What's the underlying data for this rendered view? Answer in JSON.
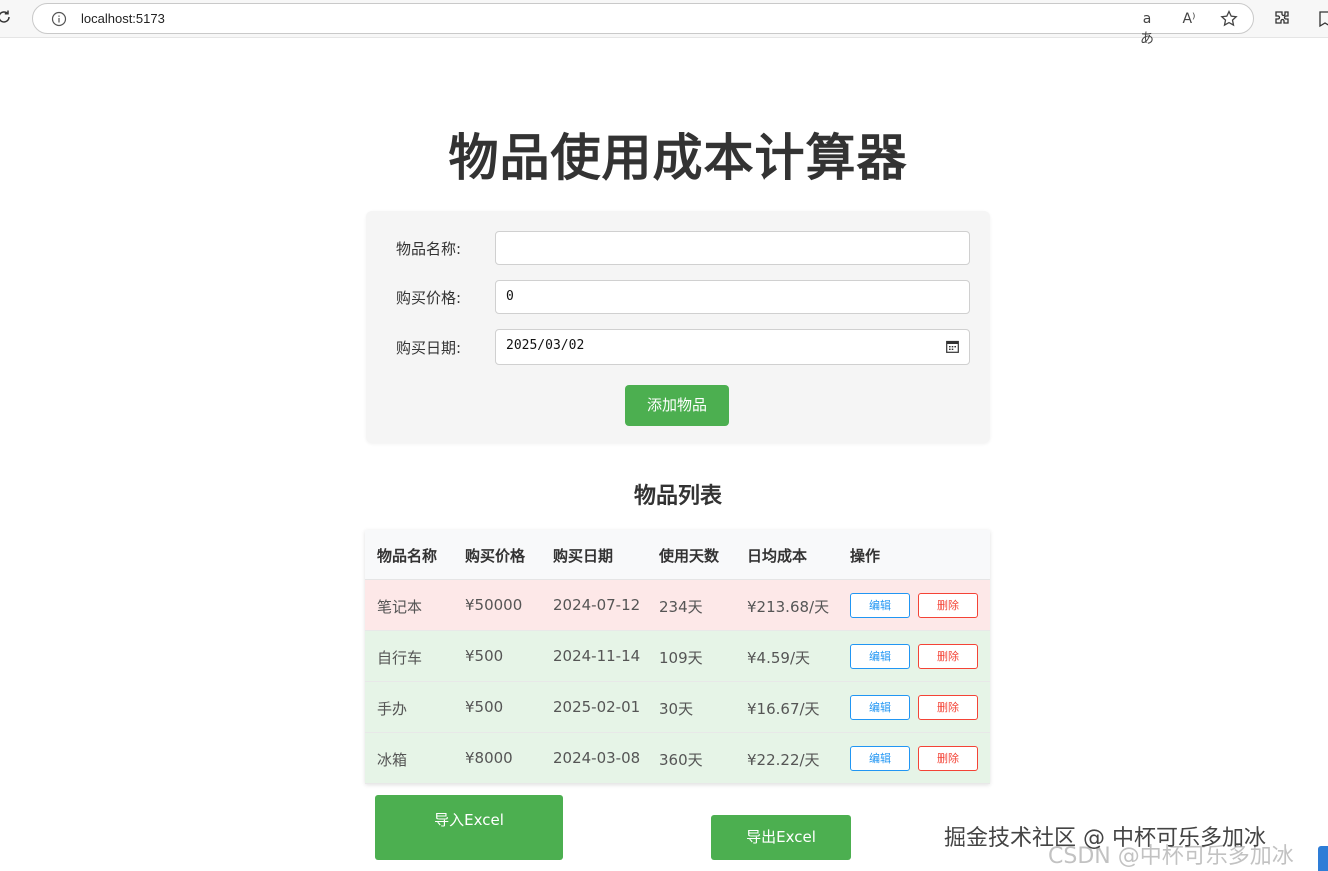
{
  "browser": {
    "url": "localhost:5173"
  },
  "page": {
    "title": "物品使用成本计算器"
  },
  "form": {
    "name_label": "物品名称:",
    "name_value": "",
    "price_label": "购买价格:",
    "price_value": "0",
    "date_label": "购买日期:",
    "date_value": "2025/03/02",
    "add_button": "添加物品"
  },
  "list": {
    "title": "物品列表",
    "columns": [
      "物品名称",
      "购买价格",
      "购买日期",
      "使用天数",
      "日均成本",
      "操作"
    ],
    "rows": [
      {
        "name": "笔记本",
        "price": "¥50000",
        "date": "2024-07-12",
        "days": "234天",
        "daily": "¥213.68/天",
        "edit": "编辑",
        "delete": "删除",
        "highlight": "#fde8e8"
      },
      {
        "name": "自行车",
        "price": "¥500",
        "date": "2024-11-14",
        "days": "109天",
        "daily": "¥4.59/天",
        "edit": "编辑",
        "delete": "删除",
        "highlight": "#e6f4e7"
      },
      {
        "name": "手办",
        "price": "¥500",
        "date": "2025-02-01",
        "days": "30天",
        "daily": "¥16.67/天",
        "edit": "编辑",
        "delete": "删除",
        "highlight": "#e6f4e7"
      },
      {
        "name": "冰箱",
        "price": "¥8000",
        "date": "2024-03-08",
        "days": "360天",
        "daily": "¥22.22/天",
        "edit": "编辑",
        "delete": "删除",
        "highlight": "#e6f4e7"
      }
    ]
  },
  "actions": {
    "import": "导入Excel",
    "export": "导出Excel"
  },
  "watermark": {
    "line1": "掘金技术社区 @ 中杯可乐多加冰",
    "line2": "CSDN @中杯可乐多加冰"
  },
  "colors": {
    "primary": "#4caf50",
    "edit": "#2196f3",
    "delete": "#f44336"
  },
  "icons": {
    "reload": "reload-icon",
    "info": "info-icon",
    "translate": "translate-icon",
    "read_aloud": "read-aloud-icon",
    "favorite": "star-icon",
    "extensions": "puzzle-icon",
    "calendar": "calendar-icon"
  }
}
